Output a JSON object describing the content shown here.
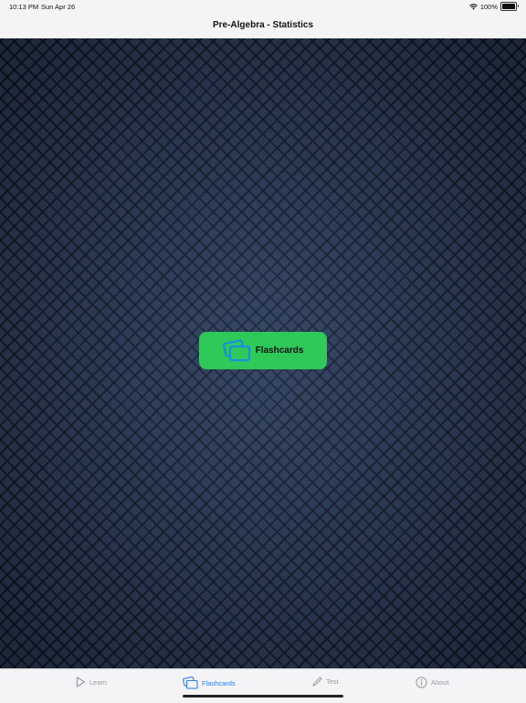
{
  "status_bar": {
    "time": "10:13 PM",
    "date": "Sun Apr 26",
    "battery_percent": "100%",
    "wifi_icon": "wifi-icon",
    "battery_icon": "battery-icon"
  },
  "nav": {
    "title": "Pre-Algebra - Statistics"
  },
  "main": {
    "flashcards_button_label": "Flashcards",
    "flashcards_button_icon": "flashcards-icon",
    "button_color": "#2fc95a"
  },
  "tab_bar": {
    "active_color": "#2d7cf6",
    "inactive_color": "#9a9aa0",
    "tabs": [
      {
        "label": "Learn",
        "icon": "play-icon",
        "active": false
      },
      {
        "label": "Flashcards",
        "icon": "flashcards-icon",
        "active": true
      },
      {
        "label": "Test",
        "icon": "pencil-icon",
        "active": false
      },
      {
        "label": "About",
        "icon": "info-icon",
        "active": false
      }
    ]
  }
}
